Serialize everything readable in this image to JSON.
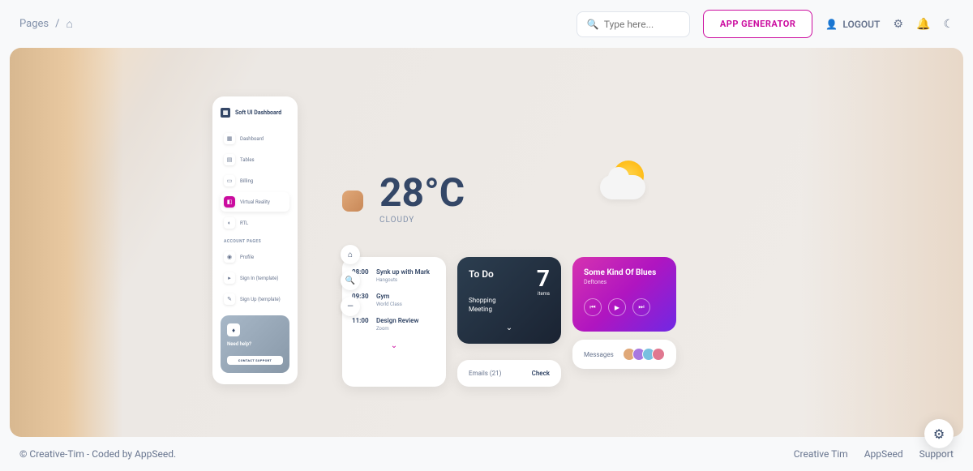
{
  "breadcrumb": {
    "root": "Pages"
  },
  "search": {
    "placeholder": "Type here..."
  },
  "buttons": {
    "app_generator": "APP GENERATOR",
    "logout": "LOGOUT"
  },
  "sidebar": {
    "brand": "Soft UI Dashboard",
    "items": [
      {
        "label": "Dashboard",
        "icon": "▦"
      },
      {
        "label": "Tables",
        "icon": "▤"
      },
      {
        "label": "Billing",
        "icon": "▭"
      },
      {
        "label": "Virtual Reality",
        "icon": "◧"
      },
      {
        "label": "RTL",
        "icon": "◐"
      }
    ],
    "section_label": "ACCOUNT PAGES",
    "account_items": [
      {
        "label": "Profile",
        "icon": "◉"
      },
      {
        "label": "Sign In (template)",
        "icon": "▸"
      },
      {
        "label": "Sign Up (template)",
        "icon": "✎"
      }
    ],
    "help": {
      "title": "Need help?",
      "button": "CONTACT SUPPORT"
    }
  },
  "weather": {
    "temp": "28°C",
    "condition": "CLOUDY"
  },
  "schedule": [
    {
      "time": "08:00",
      "title": "Synk up with Mark",
      "sub": "Hangouts"
    },
    {
      "time": "09:30",
      "title": "Gym",
      "sub": "World Class"
    },
    {
      "time": "11:00",
      "title": "Design Review",
      "sub": "Zoom"
    }
  ],
  "todo": {
    "title": "To Do",
    "count": "7",
    "items_label": "items",
    "sub1": "Shopping",
    "sub2": "Meeting"
  },
  "emails": {
    "label": "Emails (21)",
    "action": "Check"
  },
  "music": {
    "title": "Some Kind Of Blues",
    "artist": "Deftones"
  },
  "messages": {
    "label": "Messages"
  },
  "footer": {
    "copyright": "© Creative-Tim - Coded by AppSeed.",
    "links": [
      "Creative Tim",
      "AppSeed",
      "Support"
    ]
  }
}
